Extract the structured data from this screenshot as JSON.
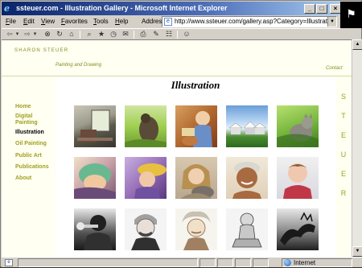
{
  "window": {
    "title": "ssteuer.com - Illustration Gallery - Microsoft Internet Explorer",
    "min": "_",
    "max": "□",
    "close": "×"
  },
  "menu": {
    "items": [
      "File",
      "Edit",
      "View",
      "Favorites",
      "Tools",
      "Help"
    ],
    "address_label": "Address",
    "url": "http://www.ssteuer.com/gallery.asp?Category=Illustration"
  },
  "toolbar": {
    "back": "⇦",
    "back_drop": "▾",
    "forward": "⇨",
    "forward_drop": "▾",
    "stop": "⊗",
    "refresh": "↻",
    "home": "⌂",
    "search": "⌕",
    "favorites": "★",
    "history": "◷",
    "mail": "✉",
    "print": "⎙",
    "edit": "✎",
    "discuss": "☷",
    "messenger": "☺"
  },
  "site": {
    "name": "SHARON STEUER",
    "tagline": "Painting and Drawing",
    "contact": "Contact",
    "heading": "Illustration",
    "vertical_word": [
      "S",
      "T",
      "E",
      "U",
      "E",
      "R"
    ]
  },
  "nav": [
    {
      "label": "Home",
      "active": false
    },
    {
      "label": "Digital Painting",
      "active": false
    },
    {
      "label": "Illustration",
      "active": true
    },
    {
      "label": "Oil Painting",
      "active": false
    },
    {
      "label": "Public Art",
      "active": false
    },
    {
      "label": "Publications",
      "active": false
    },
    {
      "label": "About",
      "active": false
    }
  ],
  "gallery": {
    "rows": [
      [
        "window-and-chair-thumbnail",
        "dog-in-grass-thumbnail",
        "child-with-sandwich-thumbnail",
        "snowy-village-thumbnail",
        "cat-in-grass-thumbnail"
      ],
      [
        "sleeping-baby-thumbnail",
        "girl-in-hat-thumbnail",
        "girl-with-cat-thumbnail",
        "smiling-child-thumbnail",
        "toddler-thumbnail"
      ],
      [
        "trumpet-player-thumbnail",
        "mark-twain-portrait-thumbnail",
        "einstein-portrait-thumbnail",
        "seated-child-sketch-thumbnail",
        "dragon-sketch-thumbnail"
      ]
    ]
  },
  "scrollbar": {
    "up": "▲",
    "down": "▼"
  },
  "status": {
    "zone": "Internet",
    "done_icon": "e"
  }
}
